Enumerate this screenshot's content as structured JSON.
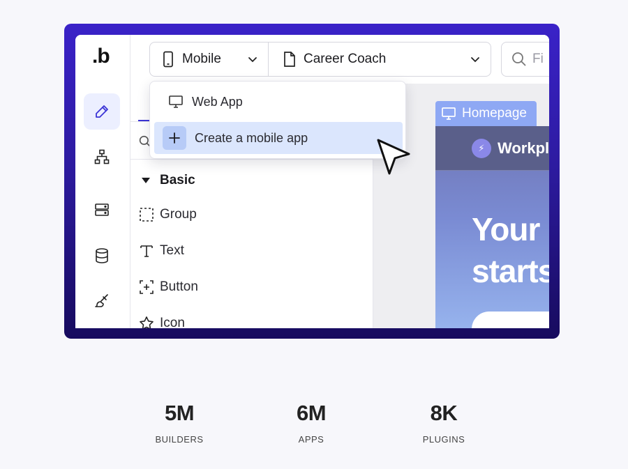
{
  "brand": {
    "logo": ".b"
  },
  "topbar": {
    "platform_selector": "Mobile",
    "app_selector": "Career Coach",
    "search_placeholder": "Fi"
  },
  "dropdown": {
    "items": [
      {
        "label": "Web App",
        "icon": "monitor-icon"
      },
      {
        "label": "Create a mobile app",
        "icon": "plus-icon",
        "highlighted": true
      }
    ]
  },
  "sidebar": {
    "items": [
      {
        "name": "design",
        "icon": "pencil-icon",
        "active": true
      },
      {
        "name": "workflow",
        "icon": "hierarchy-icon"
      },
      {
        "name": "data",
        "icon": "server-icon"
      },
      {
        "name": "database",
        "icon": "database-icon"
      },
      {
        "name": "styles",
        "icon": "brush-icon"
      }
    ]
  },
  "panel": {
    "section": "Basic",
    "elements": [
      {
        "label": "Group",
        "icon": "dashed-square-icon"
      },
      {
        "label": "Text",
        "icon": "text-icon"
      },
      {
        "label": "Button",
        "icon": "button-icon"
      },
      {
        "label": "Icon",
        "icon": "star-icon"
      }
    ]
  },
  "canvas": {
    "page_tag": "Homepage",
    "preview": {
      "brand": "Workpla",
      "hero_line1": "Your",
      "hero_line2": "starts"
    }
  },
  "stats": [
    {
      "value": "5M",
      "label": "BUILDERS"
    },
    {
      "value": "6M",
      "label": "APPS"
    },
    {
      "value": "8K",
      "label": "PLUGINS"
    }
  ],
  "colors": {
    "frame_gradient_top": "#3a22c8",
    "frame_gradient_bottom": "#170b5e",
    "accent": "#3b34d6",
    "highlight": "#dbe6fd",
    "page_tag": "#8ea8f4"
  }
}
